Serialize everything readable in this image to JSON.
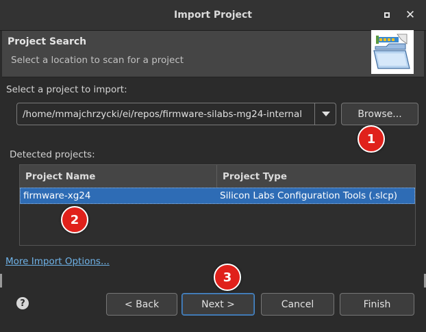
{
  "window": {
    "title": "Import Project"
  },
  "header": {
    "title": "Project Search",
    "description": "Select a location to scan for a project"
  },
  "select_label": "Select a project to import:",
  "path_combo": {
    "value": "/home/mmajchrzycki/ei/repos/firmware-silabs-mg24-internal"
  },
  "browse_button": "Browse...",
  "detected_label": "Detected projects:",
  "table": {
    "columns": [
      "Project Name",
      "Project Type"
    ],
    "rows": [
      {
        "name": "firmware-xg24",
        "type": "Silicon Labs Configuration Tools (.slcp)"
      }
    ]
  },
  "more_options_link": "More Import Options...",
  "help_glyph": "?",
  "buttons": {
    "back": "< Back",
    "next": "Next >",
    "cancel": "Cancel",
    "finish": "Finish"
  },
  "markers": [
    "1",
    "2",
    "3"
  ],
  "colors": {
    "selection": "#2e6cb5",
    "link": "#6fb3e8",
    "marker": "#e0211b"
  }
}
